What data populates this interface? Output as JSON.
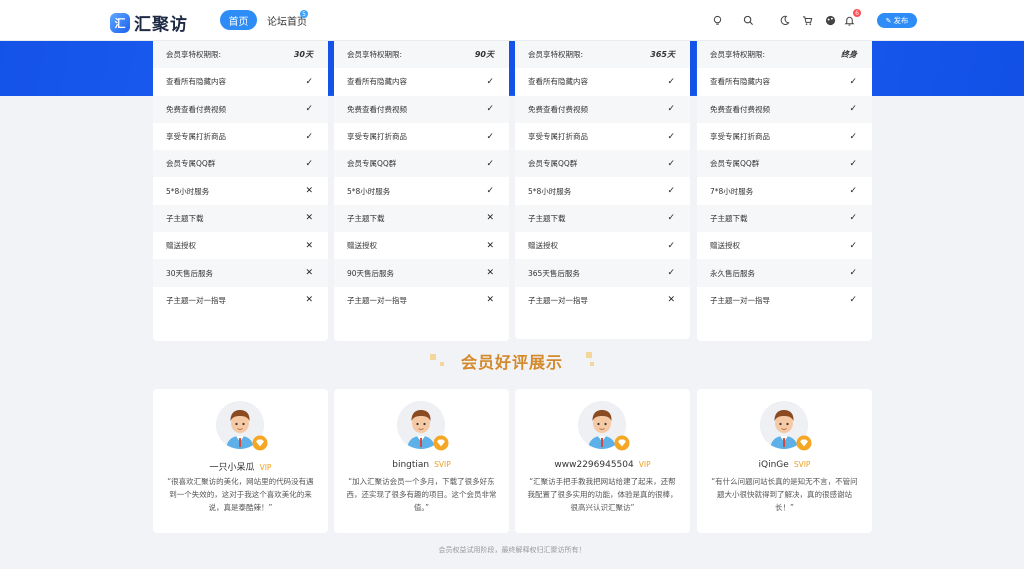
{
  "header": {
    "logo_mark": "汇",
    "logo_text": "汇聚访",
    "nav_home": "首页",
    "nav_forum": "论坛首页",
    "forum_badge": "5",
    "notify_badge": "6",
    "publish_label": "发布"
  },
  "plans": [
    {
      "period_label": "会员享特权期限:",
      "period_value": "30天",
      "features": [
        {
          "label": "查看所有隐藏内容",
          "ok": true
        },
        {
          "label": "免费查看付费视频",
          "ok": true
        },
        {
          "label": "享受专属打折商品",
          "ok": true
        },
        {
          "label": "会员专属QQ群",
          "ok": true
        },
        {
          "label": "5*8小时服务",
          "ok": false
        },
        {
          "label": "子主题下载",
          "ok": false
        },
        {
          "label": "赠送授权",
          "ok": false
        },
        {
          "label": "30天售后服务",
          "ok": false
        },
        {
          "label": "子主题一对一指导",
          "ok": false
        }
      ]
    },
    {
      "period_label": "会员享特权期限:",
      "period_value": "90天",
      "features": [
        {
          "label": "查看所有隐藏内容",
          "ok": true
        },
        {
          "label": "免费查看付费视频",
          "ok": true
        },
        {
          "label": "享受专属打折商品",
          "ok": true
        },
        {
          "label": "会员专属QQ群",
          "ok": true
        },
        {
          "label": "5*8小时服务",
          "ok": true
        },
        {
          "label": "子主题下载",
          "ok": false
        },
        {
          "label": "赠送授权",
          "ok": false
        },
        {
          "label": "90天售后服务",
          "ok": false
        },
        {
          "label": "子主题一对一指导",
          "ok": false
        }
      ]
    },
    {
      "period_label": "会员享特权期限:",
      "period_value": "365天",
      "features": [
        {
          "label": "查看所有隐藏内容",
          "ok": true
        },
        {
          "label": "免费查看付费视频",
          "ok": true
        },
        {
          "label": "享受专属打折商品",
          "ok": true
        },
        {
          "label": "会员专属QQ群",
          "ok": true
        },
        {
          "label": "5*8小时服务",
          "ok": true
        },
        {
          "label": "子主题下载",
          "ok": true
        },
        {
          "label": "赠送授权",
          "ok": true
        },
        {
          "label": "365天售后服务",
          "ok": true
        },
        {
          "label": "子主题一对一指导",
          "ok": false
        }
      ]
    },
    {
      "period_label": "会员享特权期限:",
      "period_value": "终身",
      "features": [
        {
          "label": "查看所有隐藏内容",
          "ok": true
        },
        {
          "label": "免费查看付费视频",
          "ok": true
        },
        {
          "label": "享受专属打折商品",
          "ok": true
        },
        {
          "label": "会员专属QQ群",
          "ok": true
        },
        {
          "label": "7*8小时服务",
          "ok": true
        },
        {
          "label": "子主题下载",
          "ok": true
        },
        {
          "label": "赠送授权",
          "ok": true
        },
        {
          "label": "永久售后服务",
          "ok": true
        },
        {
          "label": "子主题一对一指导",
          "ok": true
        }
      ]
    }
  ],
  "reviews_title": "会员好评展示",
  "reviews": [
    {
      "name": "一只小呆瓜",
      "level": "VIP",
      "text": "“很喜欢汇聚访的美化，网站里的代码没有遇到一个失效的，这对于我这个喜欢美化的来说，真是泰酷辣！”"
    },
    {
      "name": "bingtian",
      "level": "SVIP",
      "text": "“加入汇聚访会员一个多月，下载了很多好东西，还实现了很多有趣的项目。这个会员非常值。”"
    },
    {
      "name": "www2296945504",
      "level": "VIP",
      "text": "“汇聚访手把手教我把网站给建了起来，还帮我配置了很多实用的功能，体验是真的很棒，很高兴认识汇聚访”"
    },
    {
      "name": "iQinGe",
      "level": "SVIP",
      "text": "“有什么问题问站长真的是知无不言，不管问题大小很快就得到了解决，真的很感谢站长！”"
    }
  ],
  "footer_note": "会员权益试用阶段，最终解释权归汇聚访所有！",
  "colors": {
    "accent": "#2d8cf6",
    "band": "#1553e8",
    "gold": "#d4892b"
  },
  "icons": {
    "check": "check-icon",
    "cross": "cross-icon"
  }
}
